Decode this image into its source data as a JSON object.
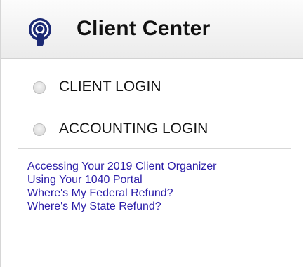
{
  "header": {
    "title": "Client Center",
    "icon": "podcast-icon",
    "icon_color": "#1c2a74"
  },
  "logins": [
    {
      "label": "CLIENT LOGIN",
      "icon": "radio-icon"
    },
    {
      "label": "ACCOUNTING LOGIN",
      "icon": "radio-icon"
    }
  ],
  "links": [
    {
      "label": "Accessing Your 2019 Client Organizer"
    },
    {
      "label": "Using Your 1040 Portal"
    },
    {
      "label": "Where's My Federal Refund?"
    },
    {
      "label": "Where's My State Refund?"
    }
  ],
  "colors": {
    "link": "#2a1ca8",
    "title": "#111111"
  }
}
